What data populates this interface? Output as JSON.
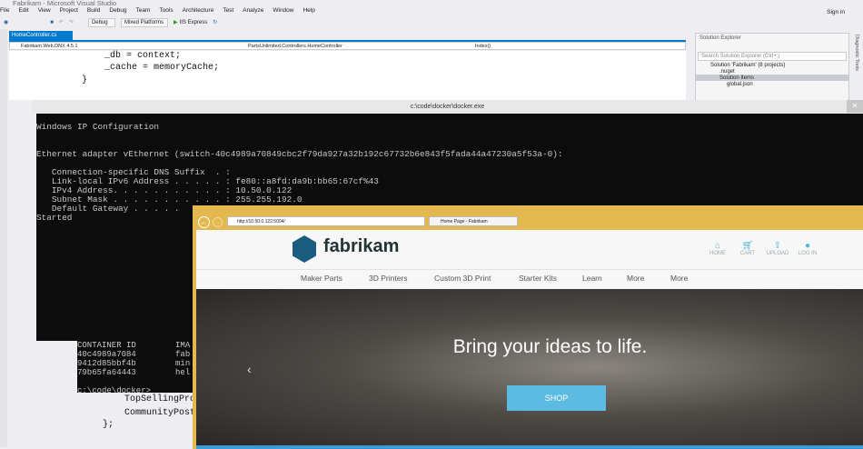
{
  "window": {
    "title": "Fabrikam - Microsoft Visual Studio",
    "sign_in": "Sign in"
  },
  "menu": [
    "File",
    "Edit",
    "View",
    "Project",
    "Build",
    "Debug",
    "Team",
    "Tools",
    "Architecture",
    "Test",
    "Analyze",
    "Window",
    "Help"
  ],
  "toolbar": {
    "config": "Debug",
    "platform": "Mixed Platforms",
    "run": "IIS Express"
  },
  "editor": {
    "tab": "HomeController.cs",
    "project": "Fabrikam.Web.DNX 4.5.1",
    "class": "PartsUnlimited.Controllers.HomeController",
    "member": "Index()",
    "lines_top": [
      "_db = context;",
      "_cache = memoryCache;",
      "}"
    ],
    "lines_bottom": [
      "TopSellingPro",
      "CommunityPost",
      "};"
    ]
  },
  "solution_explorer": {
    "title": "Solution Explorer",
    "search_placeholder": "Search Solution Explorer (Ctrl+;)",
    "items": [
      "Solution 'Fabrikam' (8 projects)",
      ".nuget",
      "Solution Items",
      "global.json"
    ],
    "side_tab": "Diagnostic Tools"
  },
  "console": {
    "title": "c:\\code\\docker\\docker.exe",
    "lines": [
      "Windows IP Configuration",
      "",
      "",
      "Ethernet adapter vEthernet (switch-40c4989a70849cbc2f79da927a32b192c67732b6e843f5fada44a47230a5f53a-0):",
      "",
      "   Connection-specific DNS Suffix  . :",
      "   Link-local IPv6 Address . . . . . : fe80::a8fd:da9b:bb65:67cf%43",
      "   IPv4 Address. . . . . . . . . . . : 10.50.0.122",
      "   Subnet Mask . . . . . . . . . . . : 255.255.192.0",
      "   Default Gateway . . . . .",
      "Started"
    ]
  },
  "console2": {
    "lines": [
      "CONTAINER ID        IMA",
      "40c4989a7084        fab",
      "9412d85bbf4b        min",
      "79b65fa64443        hel",
      "",
      "c:\\code\\docker>"
    ]
  },
  "browser": {
    "url": "http://10.50.0.122:5004/",
    "tab": "Home Page - Fabrikam",
    "logo": "fabrikam",
    "icons": [
      {
        "name": "home",
        "label": "HOME"
      },
      {
        "name": "cart",
        "label": "CART"
      },
      {
        "name": "upload",
        "label": "UPLOAD"
      },
      {
        "name": "user",
        "label": "LOG IN"
      }
    ],
    "nav": [
      "Maker Parts",
      "3D Printers",
      "Custom 3D Print",
      "Starter Kits",
      "Learn",
      "More",
      "More"
    ],
    "hero_text": "Bring your ideas to life.",
    "cta": "SHOP",
    "accent": "#5bbbe0"
  }
}
